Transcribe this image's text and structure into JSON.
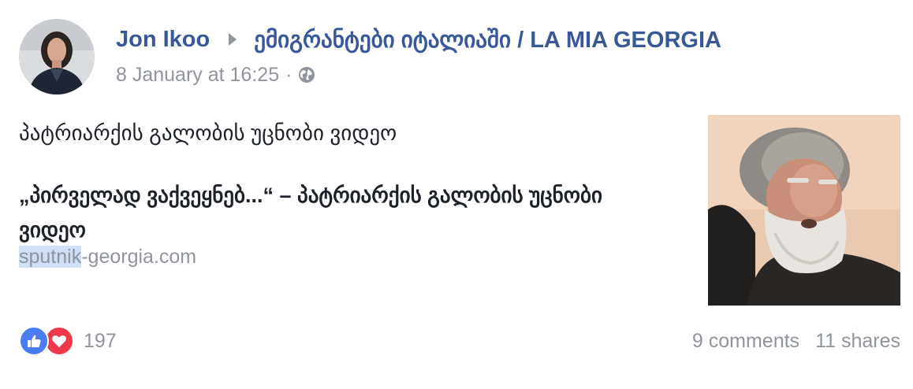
{
  "post": {
    "author": "Jon Ikoo",
    "group": "ემიგრანტები იტალიაში / LA MIA GEORGIA",
    "timestamp": "8 January at 16:25",
    "separator": "·",
    "privacy_icon": "globe-icon",
    "text": "პატრიარქის გალობის უცნობი ვიდეო"
  },
  "link_preview": {
    "title": "„პირველად ვაქვეყნებ...“ – პატრიარქის გალობის უცნობი ვიდეო",
    "domain_highlight": "sputnik",
    "domain_rest": "-georgia.com"
  },
  "footer": {
    "reaction_icons": [
      "like-icon",
      "love-icon"
    ],
    "reaction_count": "197",
    "comments": "9 comments",
    "shares": "11 shares"
  },
  "colors": {
    "link_blue": "#385898",
    "meta_grey": "#90949c",
    "like_blue": "#4a7df2",
    "love_red": "#f0384b",
    "text": "#1d2129"
  }
}
